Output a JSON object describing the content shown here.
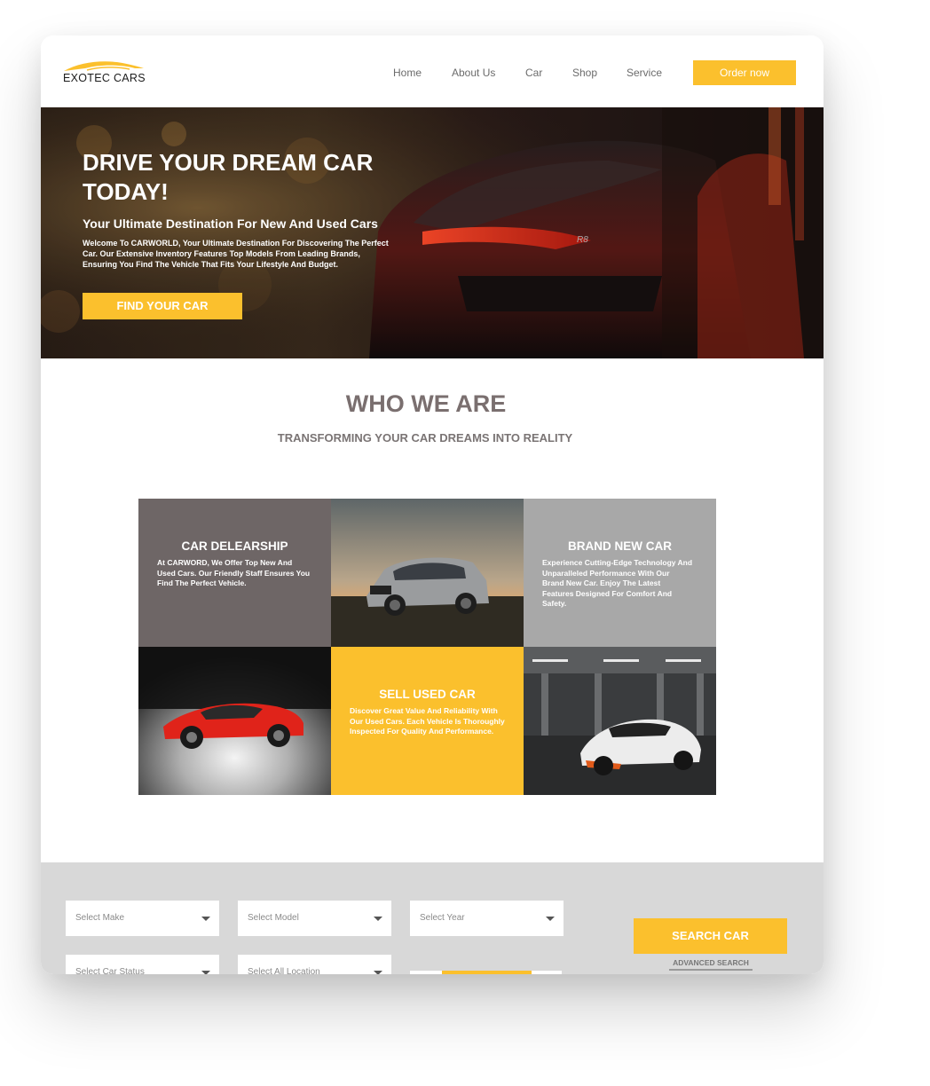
{
  "brand": {
    "name": "EXOTEC CARS",
    "accent": "#fbc02d"
  },
  "nav": {
    "links": [
      "Home",
      "About Us",
      "Car",
      "Shop",
      "Service"
    ],
    "order_label": "Order now"
  },
  "hero": {
    "title": "DRIVE YOUR DREAM CAR TODAY!",
    "subtitle": "Your Ultimate Destination For New And Used Cars",
    "text": "Welcome To CARWORLD, Your Ultimate Destination For Discovering The Perfect Car. Our Extensive Inventory Features Top Models From Leading Brands, Ensuring You Find The Vehicle That Fits Your Lifestyle And Budget.",
    "button_label": "FIND YOUR CAR"
  },
  "who": {
    "title": "WHO WE ARE",
    "subtitle": "TRANSFORMING YOUR CAR DREAMS INTO REALITY"
  },
  "cards": {
    "dealership": {
      "title": "CAR DELEARSHIP",
      "text": "At CARWORD, We Offer Top New And Used Cars. Our Friendly Staff Ensures You Find The Perfect Vehicle."
    },
    "brand_new": {
      "title": "BRAND NEW CAR",
      "text": "Experience Cutting-Edge Technology And Unparalleled Performance With Our Brand New Car. Enjoy The Latest Features Designed For Comfort And Safety."
    },
    "sell_used": {
      "title": "SELL USED CAR",
      "text": "Discover Great Value And Reliability With Our Used Cars. Each Vehicle Is Thoroughly Inspected For Quality And Performance."
    }
  },
  "search": {
    "selects": [
      "Select Make",
      "Select Model",
      "Select Year",
      "Select Car Status",
      "Select All Location"
    ],
    "button_label": "SEARCH CAR",
    "advanced_label": "ADVANCED SEARCH"
  }
}
